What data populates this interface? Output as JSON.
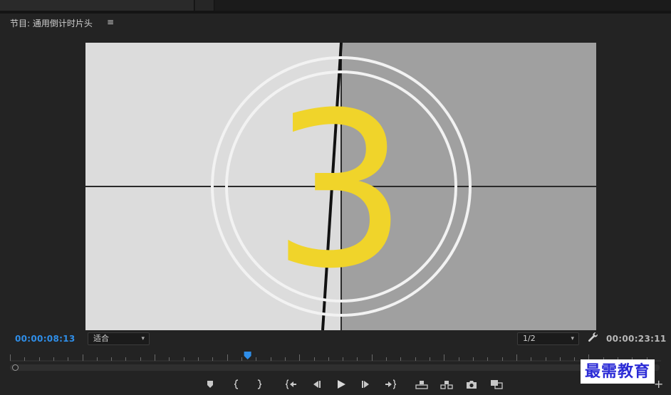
{
  "panel": {
    "title": "节目: 通用倒计时片头",
    "menu_glyph": "≡"
  },
  "monitor": {
    "countdown_number": "3",
    "colors": {
      "left_background": "#dcdcdc",
      "right_background": "#a0a0a0",
      "circle": "#f2f2f2",
      "number": "#f0d42a",
      "crosshair": "#2a2a2a"
    }
  },
  "timecode": {
    "current": "00:00:08:13",
    "duration": "00:00:23:11",
    "current_color": "#2f8ee8"
  },
  "zoom_select": {
    "value": "适合"
  },
  "resolution_select": {
    "value": "1/2"
  },
  "playhead": {
    "fraction": 0.365,
    "color": "#2f8ee8"
  },
  "controls": {
    "buttons": [
      {
        "name": "add-marker-button",
        "icon": "marker-icon"
      },
      {
        "name": "mark-in-button",
        "icon": "bracket-left-icon"
      },
      {
        "name": "mark-out-button",
        "icon": "bracket-right-icon"
      },
      {
        "name": "go-to-in-button",
        "icon": "go-to-in-icon"
      },
      {
        "name": "step-back-button",
        "icon": "step-back-icon"
      },
      {
        "name": "play-button",
        "icon": "play-icon"
      },
      {
        "name": "step-forward-button",
        "icon": "step-forward-icon"
      },
      {
        "name": "go-to-out-button",
        "icon": "go-to-out-icon"
      },
      {
        "name": "lift-button",
        "icon": "lift-icon"
      },
      {
        "name": "extract-button",
        "icon": "extract-icon"
      },
      {
        "name": "export-frame-button",
        "icon": "camera-icon"
      },
      {
        "name": "compare-view-button",
        "icon": "compare-icon"
      }
    ],
    "add_glyph": "+"
  },
  "watermark": {
    "text": "最需教育"
  }
}
